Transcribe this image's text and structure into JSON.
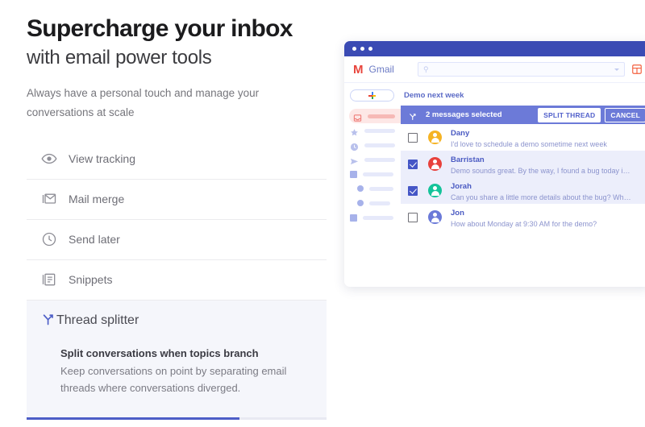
{
  "hero": {
    "headline": "Supercharge your inbox",
    "subhead": "with email power tools",
    "lede": "Always have a personal touch and manage your conversations at scale"
  },
  "features": [
    {
      "label": "View tracking",
      "icon": "eye-icon"
    },
    {
      "label": "Mail merge",
      "icon": "envelope-stack-icon"
    },
    {
      "label": "Send later",
      "icon": "clock-icon"
    },
    {
      "label": "Snippets",
      "icon": "documents-stack-icon"
    }
  ],
  "active_feature": {
    "label": "Thread splitter",
    "icon": "thread-split-icon",
    "title": "Split conversations when topics branch",
    "description": "Keep conversations on point by separating email threads where conversations diverged.",
    "progress_percent": 71
  },
  "mock": {
    "titlebar_dots": 3,
    "brand": {
      "logo": "M",
      "name": "Gmail"
    },
    "search": {
      "value": "",
      "placeholder": "",
      "icon": "search-icon",
      "caret": "chevron-down-icon"
    },
    "header_action_icon": "split-layout-icon",
    "compose": {
      "icon": "plus-icon"
    },
    "sidebar_items": [
      {
        "icon": "inbox-icon",
        "active": true
      },
      {
        "icon": "star-icon",
        "active": false
      },
      {
        "icon": "clock-icon",
        "active": false
      },
      {
        "icon": "send-icon",
        "active": false
      },
      {
        "icon": "square-icon",
        "active": false
      },
      {
        "icon": "circle-icon",
        "active": false
      },
      {
        "icon": "circle-icon",
        "active": false
      },
      {
        "icon": "square-icon",
        "active": false
      }
    ],
    "thread_title": "Demo next week",
    "action_bar": {
      "icon": "thread-split-icon",
      "status": "2 messages selected",
      "split_label": "SPLIT THREAD",
      "cancel_label": "CANCEL"
    },
    "messages": [
      {
        "name": "Dany",
        "snippet": "I'd love to schedule a demo sometime next week",
        "checked": false,
        "avatar_color": "#f5b324"
      },
      {
        "name": "Barristan",
        "snippet": "Demo sounds great. By the way, I found a bug today in the ...",
        "checked": true,
        "avatar_color": "#e8413c"
      },
      {
        "name": "Jorah",
        "snippet": "Can you share a little more details about the bug? Where d...",
        "checked": true,
        "avatar_color": "#15c39a"
      },
      {
        "name": "Jon",
        "snippet": "How about Monday at 9:30 AM for the demo?",
        "checked": false,
        "avatar_color": "#6b7ad8"
      }
    ]
  },
  "colors": {
    "accent": "#4d5ec7",
    "titlebar": "#3b4bb4",
    "action_bar": "#6c7ad8",
    "inbox_highlight": "#fde7e6",
    "panel_bg": "#f5f6fb"
  }
}
